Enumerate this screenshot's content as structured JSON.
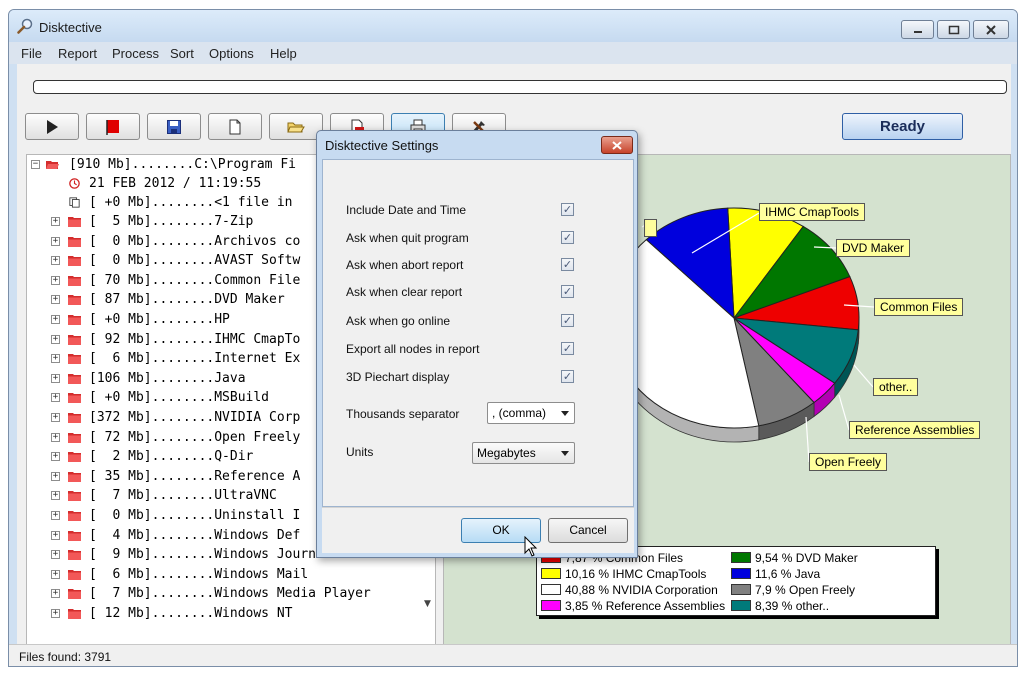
{
  "window": {
    "title": "Disktective"
  },
  "menu": [
    "File",
    "Report",
    "Process",
    "Sort",
    "Options",
    "Help"
  ],
  "toolbar": {
    "buttons": [
      "play-icon",
      "stop-icon",
      "save-icon",
      "new-document-icon",
      "open-folder-icon",
      "pdf-export-icon",
      "print-icon",
      "tools-icon"
    ],
    "status_button": "Ready"
  },
  "tree": {
    "root": "[910 Mb]........C:\\Program Fi",
    "date": "21 FEB 2012 / 11:19:55",
    "files": "[ +0 Mb]........<1 file in",
    "items": [
      "[  5 Mb]........7-Zip",
      "[  0 Mb]........Archivos co",
      "[  0 Mb]........AVAST Softw",
      "[ 70 Mb]........Common File",
      "[ 87 Mb]........DVD Maker",
      "[ +0 Mb]........HP",
      "[ 92 Mb]........IHMC CmapTo",
      "[  6 Mb]........Internet Ex",
      "[106 Mb]........Java",
      "[ +0 Mb]........MSBuild",
      "[372 Mb]........NVIDIA Corp",
      "[ 72 Mb]........Open Freely",
      "[  2 Mb]........Q-Dir",
      "[ 35 Mb]........Reference A",
      "[  7 Mb]........UltraVNC",
      "[  0 Mb]........Uninstall I",
      "[  4 Mb]........Windows Def",
      "[  9 Mb]........Windows Journal",
      "[  6 Mb]........Windows Mail",
      "[  7 Mb]........Windows Media Player",
      "[ 12 Mb]........Windows NT"
    ]
  },
  "chart_data": {
    "type": "pie",
    "slices": [
      {
        "label": "Common Files",
        "value": 7.87,
        "color": "#ee0000"
      },
      {
        "label": "DVD Maker",
        "value": 9.54,
        "color": "#007700"
      },
      {
        "label": "IHMC CmapTools",
        "value": 10.16,
        "color": "#ffff00"
      },
      {
        "label": "Java",
        "value": 11.6,
        "color": "#0000dd"
      },
      {
        "label": "NVIDIA Corporation",
        "value": 40.88,
        "color": "#ffffff"
      },
      {
        "label": "Open Freely",
        "value": 7.9,
        "color": "#808080"
      },
      {
        "label": "Reference Assemblies",
        "value": 3.85,
        "color": "#ff00ff"
      },
      {
        "label": "other..",
        "value": 8.39,
        "color": "#007a7a"
      }
    ],
    "callouts": [
      "IHMC CmapTools",
      "DVD Maker",
      "Common Files",
      "other..",
      "Reference Assemblies",
      "Open Freely"
    ],
    "legend": [
      "7,87 % Common Files",
      "9,54 % DVD Maker",
      "10,16 % IHMC CmapTools",
      "11,6 % Java",
      "40,88 % NVIDIA Corporation",
      "7,9 % Open Freely",
      "3,85 % Reference Assemblies",
      "8,39 % other.."
    ]
  },
  "status": {
    "files_found": "Files found: 3791"
  },
  "dialog": {
    "title": "Disktective Settings",
    "options": [
      {
        "label": "Include Date and Time",
        "checked": true
      },
      {
        "label": "Ask when quit program",
        "checked": true
      },
      {
        "label": "Ask when abort report",
        "checked": true
      },
      {
        "label": "Ask when clear report",
        "checked": true
      },
      {
        "label": "Ask when go online",
        "checked": true
      },
      {
        "label": "Export all nodes in report",
        "checked": true
      },
      {
        "label": "3D Piechart display",
        "checked": true
      }
    ],
    "thousands_label": "Thousands separator",
    "thousands_value": ", (comma)",
    "units_label": "Units",
    "units_value": "Megabytes",
    "ok": "OK",
    "cancel": "Cancel"
  }
}
